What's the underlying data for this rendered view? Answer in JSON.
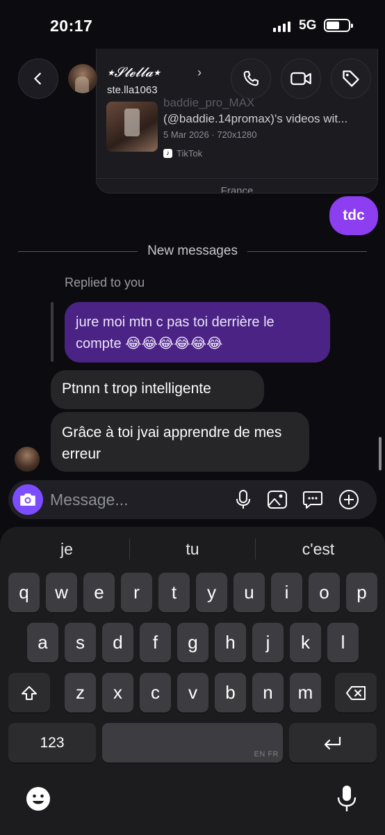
{
  "status_bar": {
    "time": "20:17",
    "network": "5G"
  },
  "header": {
    "contact_name": "⭑𝓢𝓽𝓮𝓵𝓵𝓪⭑",
    "username": "ste.lla1063"
  },
  "shared_card": {
    "title_faded": "baddie_pro_MAX",
    "title": "(@baddie.14promax)'s videos wit...",
    "meta": "5 Mar 2026 · 720x1280",
    "source": "TikTok",
    "footer": "France"
  },
  "messages": {
    "outgoing": "tdc",
    "divider_label": "New messages",
    "replied_label": "Replied to you",
    "replied_text": "jure moi mtn c pas toi derrière le compte 😂😂😂😂😂😂",
    "incoming": [
      "Ptnnn t trop intelligente",
      "Grâce à toi jvai apprendre de mes erreur"
    ]
  },
  "composer": {
    "placeholder": "Message..."
  },
  "keyboard": {
    "suggestions": [
      "je",
      "tu",
      "c'est"
    ],
    "row1": [
      "q",
      "w",
      "e",
      "r",
      "t",
      "y",
      "u",
      "i",
      "o",
      "p"
    ],
    "row2": [
      "a",
      "s",
      "d",
      "f",
      "g",
      "h",
      "j",
      "k",
      "l"
    ],
    "row3": [
      "z",
      "x",
      "c",
      "v",
      "b",
      "n",
      "m"
    ],
    "numbers_label": "123",
    "space_language": "EN FR"
  },
  "icons": {
    "back": "chevron-left-icon",
    "call": "phone-icon",
    "video": "video-camera-icon",
    "tag": "tag-icon",
    "camera": "camera-icon",
    "mic": "microphone-icon",
    "gallery": "image-icon",
    "sticker": "chat-bubble-icon",
    "add": "plus-circle-icon"
  },
  "colors": {
    "accent_purple": "#8c3ef0",
    "reply_purple": "#4a2385",
    "camera_button": "#7c4dff",
    "incoming_bubble": "#262629"
  }
}
